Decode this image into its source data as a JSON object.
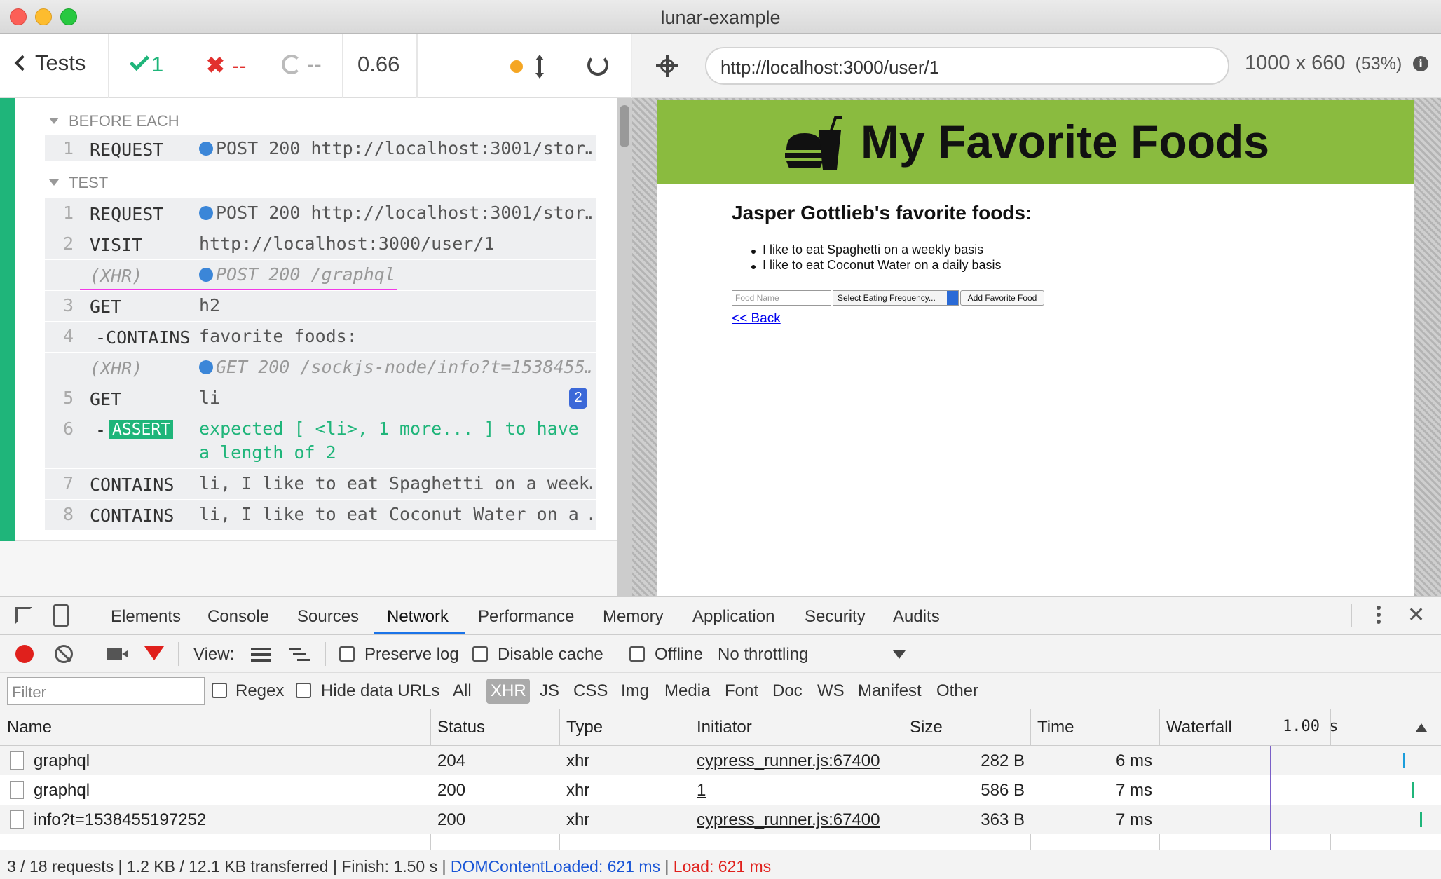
{
  "window": {
    "title": "lunar-example"
  },
  "runner": {
    "tests_label": "Tests",
    "passed": "1",
    "failed": "--",
    "pending": "--",
    "duration": "0.66"
  },
  "aut": {
    "url": "http://localhost:3000/user/1",
    "viewport": "1000 x 660",
    "scale": "(53%)"
  },
  "log": {
    "before_each_title": "BEFORE EACH",
    "test_title": "TEST",
    "before_each": [
      {
        "num": "1",
        "name": "REQUEST",
        "msg": "POST 200 http://localhost:3001/stor…"
      }
    ],
    "test": [
      {
        "num": "1",
        "name": "REQUEST",
        "msg": "POST 200 http://localhost:3001/stor…"
      },
      {
        "num": "2",
        "name": "VISIT",
        "msg": "http://localhost:3000/user/1"
      },
      {
        "num": "",
        "name": "(XHR)",
        "msg": "POST 200 /graphql"
      },
      {
        "num": "3",
        "name": "GET",
        "msg": "h2"
      },
      {
        "num": "4",
        "name": "-CONTAINS",
        "msg": "favorite foods:"
      },
      {
        "num": "",
        "name": "(XHR)",
        "msg": "GET 200 /sockjs-node/info?t=1538455…"
      },
      {
        "num": "5",
        "name": "GET",
        "msg": "li",
        "badge": "2"
      },
      {
        "num": "6",
        "name": "ASSERT",
        "msg_line1": "expected [ <li>, 1 more... ] to have",
        "msg_line2": "a length of 2"
      },
      {
        "num": "7",
        "name": "CONTAINS",
        "msg": "li, I like to eat Spaghetti on a week…"
      },
      {
        "num": "8",
        "name": "CONTAINS",
        "msg": "li, I like to eat Coconut Water on a …"
      }
    ]
  },
  "app": {
    "title": "My Favorite Foods",
    "heading": "Jasper Gottlieb's favorite foods:",
    "items": [
      "I like to eat Spaghetti on a weekly basis",
      "I like to eat Coconut Water on a daily basis"
    ],
    "food_placeholder": "Food Name",
    "frequency_selected": "Select Eating Frequency...",
    "add_button": "Add Favorite Food",
    "back_link": "<< Back"
  },
  "devtools": {
    "tabs": [
      "Elements",
      "Console",
      "Sources",
      "Network",
      "Performance",
      "Memory",
      "Application",
      "Security",
      "Audits"
    ],
    "active_tab": "Network",
    "toolbar": {
      "view_label": "View:",
      "preserve_log": "Preserve log",
      "disable_cache": "Disable cache",
      "offline": "Offline",
      "throttling": "No throttling"
    },
    "filter": {
      "placeholder": "Filter",
      "regex": "Regex",
      "hide_data_urls": "Hide data URLs",
      "types": [
        "All",
        "XHR",
        "JS",
        "CSS",
        "Img",
        "Media",
        "Font",
        "Doc",
        "WS",
        "Manifest",
        "Other"
      ],
      "active_type": "XHR"
    },
    "columns": [
      "Name",
      "Status",
      "Type",
      "Initiator",
      "Size",
      "Time",
      "Waterfall"
    ],
    "waterfall_scale": "1.00 s",
    "rows": [
      {
        "name": "graphql",
        "status": "204",
        "type": "xhr",
        "initiator": "cypress_runner.js:67400",
        "size": "282 B",
        "time": "6 ms"
      },
      {
        "name": "graphql",
        "status": "200",
        "type": "xhr",
        "initiator": "1",
        "size": "586 B",
        "time": "7 ms"
      },
      {
        "name": "info?t=1538455197252",
        "status": "200",
        "type": "xhr",
        "initiator": "cypress_runner.js:67400",
        "size": "363 B",
        "time": "7 ms"
      }
    ],
    "status_bar": {
      "summary": "3 / 18 requests | 1.2 KB / 12.1 KB transferred | Finish: 1.50 s | ",
      "dom_content_loaded": "DOMContentLoaded: 621 ms",
      "separator": " | ",
      "load": "Load: 621 ms"
    }
  },
  "colors": {
    "pass": "#1fb57a",
    "fail": "#e2312e",
    "banner": "#8abb3f",
    "highlight": "#f13ae6",
    "dom_loaded": "#1a55d6",
    "load": "#e0201c"
  }
}
